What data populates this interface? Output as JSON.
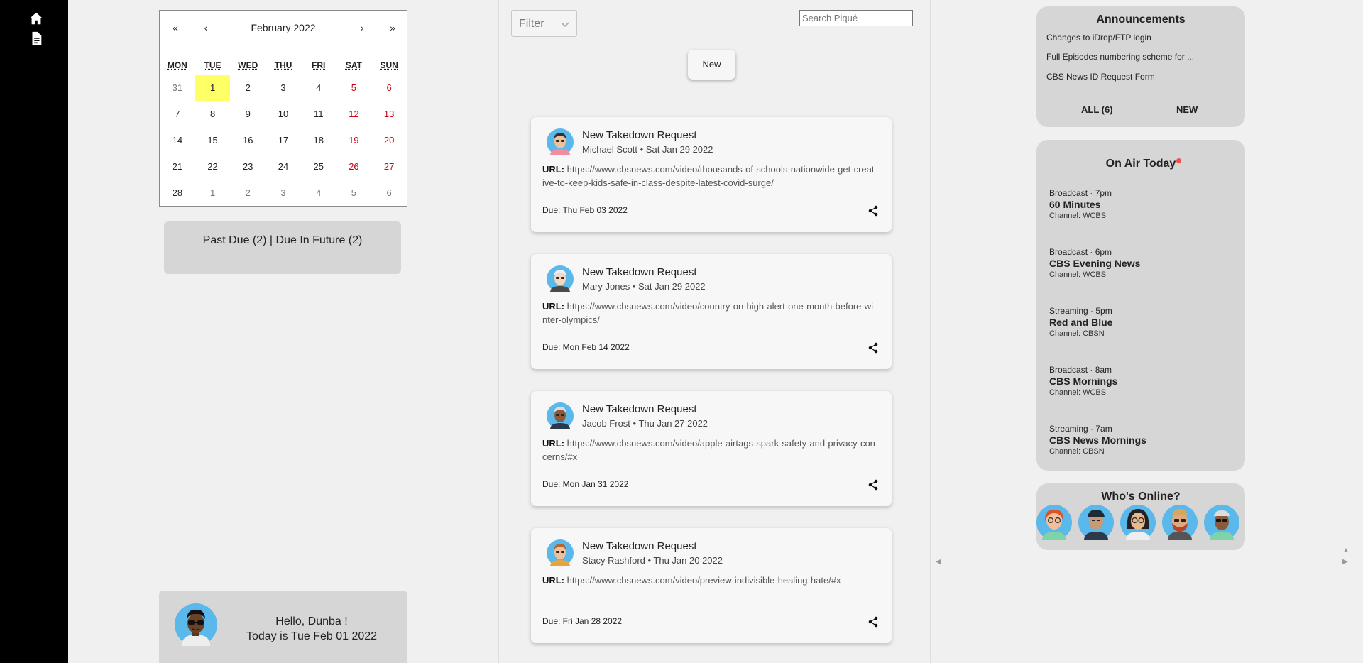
{
  "nav": {
    "home_icon": "home-icon",
    "doc_icon": "document-icon"
  },
  "calendar": {
    "prev_year": "«",
    "prev_month": "‹",
    "next_month": "›",
    "next_year": "»",
    "title": "February 2022",
    "weekdays": [
      "MON",
      "TUE",
      "WED",
      "THU",
      "FRI",
      "SAT",
      "SUN"
    ],
    "weeks": [
      [
        "31",
        "1",
        "2",
        "3",
        "4",
        "5",
        "6"
      ],
      [
        "7",
        "8",
        "9",
        "10",
        "11",
        "12",
        "13"
      ],
      [
        "14",
        "15",
        "16",
        "17",
        "18",
        "19",
        "20"
      ],
      [
        "21",
        "22",
        "23",
        "24",
        "25",
        "26",
        "27"
      ],
      [
        "28",
        "1",
        "2",
        "3",
        "4",
        "5",
        "6"
      ]
    ],
    "today": "1"
  },
  "due_summary": "Past Due (2) | Due In Future (2)",
  "greeting": {
    "line1": "Hello, Dunba !",
    "line2": "Today is Tue Feb 01 2022"
  },
  "toolbar": {
    "filter_label": "Filter",
    "search_placeholder": "Search Piqué",
    "new_label": "New"
  },
  "cards": [
    {
      "title": "New Takedown Request",
      "subtitle": "Michael Scott • Sat Jan 29 2022",
      "url_label": "URL:",
      "url": "https://www.cbsnews.com/video/thousands-of-schools-nationwide-get-creative-to-keep-kids-safe-in-class-despite-latest-covid-surge/",
      "due": "Due: Thu Feb 03 2022"
    },
    {
      "title": "New Takedown Request",
      "subtitle": "Mary Jones • Sat Jan 29 2022",
      "url_label": "URL:",
      "url": "https://www.cbsnews.com/video/country-on-high-alert-one-month-before-winter-olympics/",
      "due": "Due: Mon Feb 14 2022"
    },
    {
      "title": "New Takedown Request",
      "subtitle": "Jacob Frost • Thu Jan 27 2022",
      "url_label": "URL:",
      "url": "https://www.cbsnews.com/video/apple-airtags-spark-safety-and-privacy-concerns/#x",
      "due": "Due: Mon Jan 31 2022"
    },
    {
      "title": "New Takedown Request",
      "subtitle": "Stacy Rashford • Thu Jan 20 2022",
      "url_label": "URL:",
      "url": "https://www.cbsnews.com/video/preview-indivisible-healing-hate/#x",
      "due": "Due: Fri Jan 28 2022"
    }
  ],
  "announcements": {
    "title": "Announcements",
    "items": [
      "Changes to iDrop/FTP login",
      "Full Episodes numbering scheme for ...",
      "CBS News ID Request Form"
    ],
    "all_link": "ALL (6)",
    "new_link": "NEW"
  },
  "on_air": {
    "title": "On Air Today",
    "items": [
      {
        "meta": "Broadcast · 7pm",
        "show": "60 Minutes",
        "channel": "Channel: WCBS"
      },
      {
        "meta": "Broadcast · 6pm",
        "show": "CBS Evening News",
        "channel": "Channel: WCBS"
      },
      {
        "meta": "Streaming · 5pm",
        "show": "Red and Blue",
        "channel": "Channel: CBSN"
      },
      {
        "meta": "Broadcast · 8am",
        "show": "CBS Mornings",
        "channel": "Channel: WCBS"
      },
      {
        "meta": "Streaming · 7am",
        "show": "CBS News Mornings",
        "channel": "Channel: CBSN"
      }
    ]
  },
  "online": {
    "title": "Who's Online?"
  }
}
